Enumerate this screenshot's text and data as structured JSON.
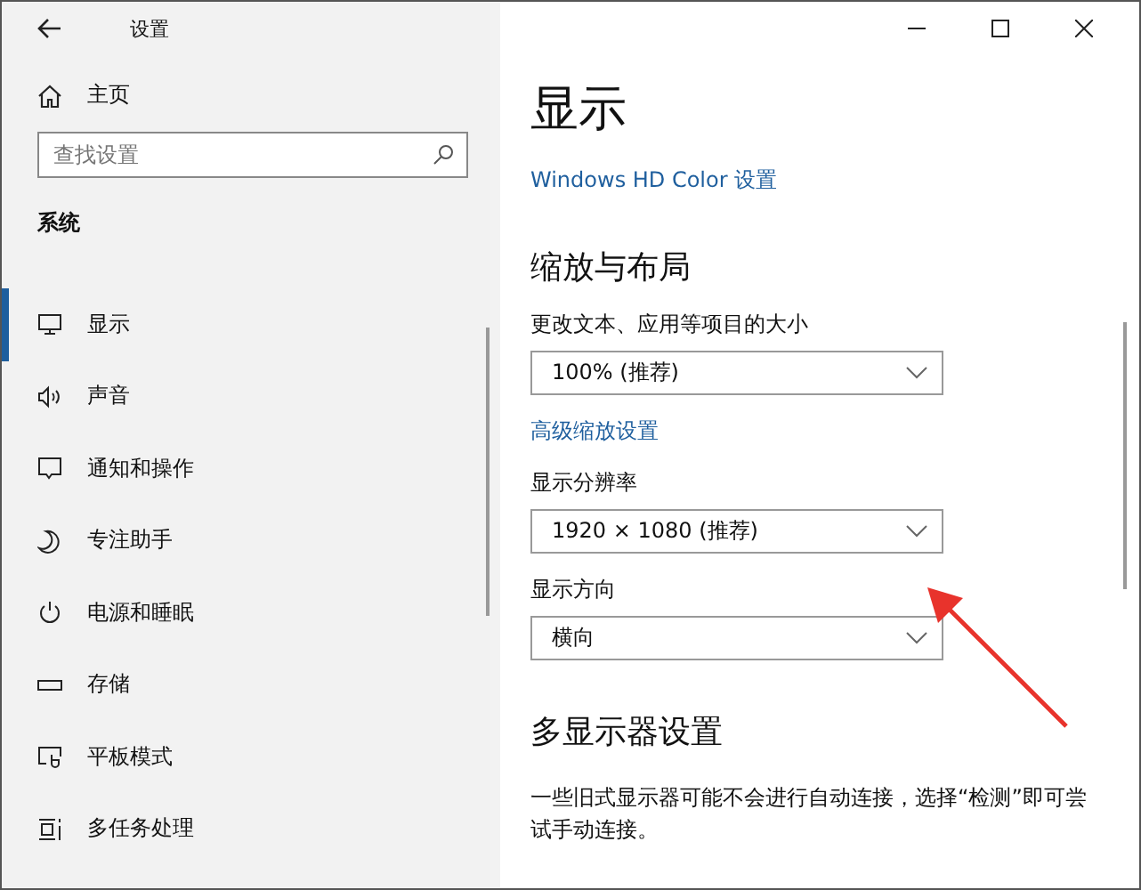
{
  "window": {
    "title": "设置"
  },
  "sidebar": {
    "home": "主页",
    "search": {
      "placeholder": "查找设置"
    },
    "section": "系统",
    "items": [
      {
        "label": "显示",
        "kind": "monitor",
        "selected": true
      },
      {
        "label": "声音",
        "kind": "speaker",
        "selected": false
      },
      {
        "label": "通知和操作",
        "kind": "message",
        "selected": false
      },
      {
        "label": "专注助手",
        "kind": "moon",
        "selected": false
      },
      {
        "label": "电源和睡眠",
        "kind": "power",
        "selected": false
      },
      {
        "label": "存储",
        "kind": "storage",
        "selected": false
      },
      {
        "label": "平板模式",
        "kind": "tablet",
        "selected": false
      },
      {
        "label": "多任务处理",
        "kind": "multitask",
        "selected": false
      }
    ]
  },
  "content": {
    "title": "显示",
    "hd_link": "Windows HD Color 设置",
    "scale_section": {
      "heading": "缩放与布局",
      "fields": [
        {
          "kind": "dropdown",
          "label": "更改文本、应用等项目的大小",
          "value": "100% (推荐)"
        },
        {
          "kind": "link",
          "label": "高级缩放设置"
        },
        {
          "kind": "dropdown",
          "label": "显示分辨率",
          "value": "1920 × 1080 (推荐)"
        },
        {
          "kind": "dropdown",
          "label": "显示方向",
          "value": "横向"
        }
      ]
    },
    "multi_section": {
      "heading": "多显示器设置",
      "description": "一些旧式显示器可能不会进行自动连接，选择“检测”即可尝试手动连接。"
    }
  }
}
